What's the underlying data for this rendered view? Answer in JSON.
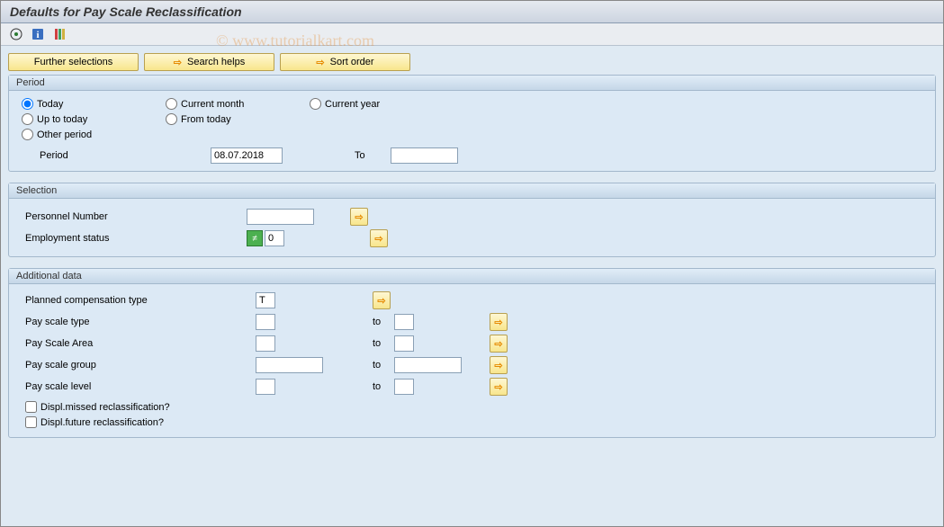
{
  "title": "Defaults for Pay Scale Reclassification",
  "watermark": "© www.tutorialkart.com",
  "toolbar_buttons": {
    "further_selections": "Further selections",
    "search_helps": "Search helps",
    "sort_order": "Sort order"
  },
  "period": {
    "header": "Period",
    "options": {
      "today": "Today",
      "current_month": "Current month",
      "current_year": "Current year",
      "up_to_today": "Up to today",
      "from_today": "From today",
      "other_period": "Other period"
    },
    "period_label": "Period",
    "period_value": "08.07.2018",
    "to_label": "To",
    "to_value": ""
  },
  "selection": {
    "header": "Selection",
    "personnel_number_label": "Personnel Number",
    "personnel_number_value": "",
    "employment_status_label": "Employment status",
    "employment_status_value": "0"
  },
  "additional": {
    "header": "Additional data",
    "planned_comp_label": "Planned compensation type",
    "planned_comp_value": "T",
    "pay_scale_type_label": "Pay scale type",
    "pay_scale_area_label": "Pay Scale Area",
    "pay_scale_group_label": "Pay scale group",
    "pay_scale_level_label": "Pay scale level",
    "to_label": "to",
    "missed_label": "Displ.missed reclassification?",
    "future_label": "Displ.future reclassification?"
  }
}
